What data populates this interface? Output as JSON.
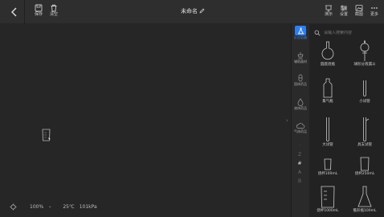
{
  "toolbar": {
    "save_label": "保存",
    "clear_label": "清空",
    "title": "未命名",
    "right": [
      {
        "label": "演示",
        "icon": "demo-icon"
      },
      {
        "label": "设置",
        "icon": "settings-icon"
      },
      {
        "label": "截图",
        "icon": "screenshot-icon"
      },
      {
        "label": "更多",
        "icon": "more-icon"
      }
    ]
  },
  "status": {
    "zoom": "100%",
    "temperature": "25℃",
    "pressure": "101kPa"
  },
  "categories": [
    {
      "label": "反应容器",
      "icon": "flask-icon",
      "active": true
    },
    {
      "label": "辅助器材",
      "icon": "stand-icon",
      "active": false
    },
    {
      "label": "固体药品",
      "icon": "capsule-icon",
      "active": false
    },
    {
      "label": "液体药品",
      "icon": "drop-icon",
      "active": false
    },
    {
      "label": "气体药品",
      "icon": "cloud-icon",
      "active": false
    }
  ],
  "index_letters": [
    "Z",
    "#",
    "A",
    "B"
  ],
  "search": {
    "placeholder": "请输入搜索内容"
  },
  "items": [
    {
      "label": "圆底烧瓶",
      "icon": "round-flask-icon"
    },
    {
      "label": "球形分液漏斗",
      "icon": "funnel-icon"
    },
    {
      "label": "集气瓶",
      "icon": "gas-bottle-icon"
    },
    {
      "label": "小试管",
      "icon": "small-tube-icon"
    },
    {
      "label": "大试管",
      "icon": "large-tube-icon"
    },
    {
      "label": "具支试管",
      "icon": "branch-tube-icon"
    },
    {
      "label": "烧杯100mL",
      "icon": "beaker-small-icon"
    },
    {
      "label": "烧杯250mL",
      "icon": "beaker-medium-icon"
    },
    {
      "label": "烧杯1000mL",
      "icon": "beaker-large-icon"
    },
    {
      "label": "锥形瓶100mL",
      "icon": "conical-flask-icon"
    }
  ]
}
